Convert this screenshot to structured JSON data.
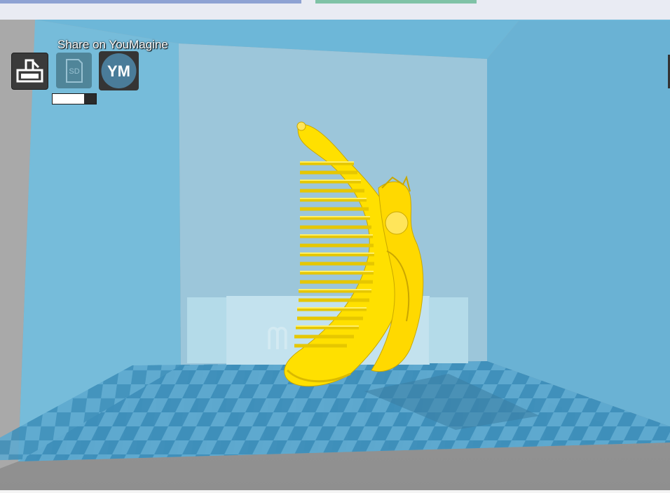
{
  "share_label": "Share on YouMagine",
  "print_icon": "printer-icon",
  "sd_icon": "sd-card-icon",
  "sd_label": "SD",
  "youmagine_label": "YM",
  "progress": {
    "fraction": 0.72
  },
  "colors": {
    "model": "#ffe000",
    "build_volume": "#6fb5d3",
    "bed_light": "#5ea9cf",
    "bed_dark": "#3e8fba",
    "floor": "#9c9c9c"
  }
}
